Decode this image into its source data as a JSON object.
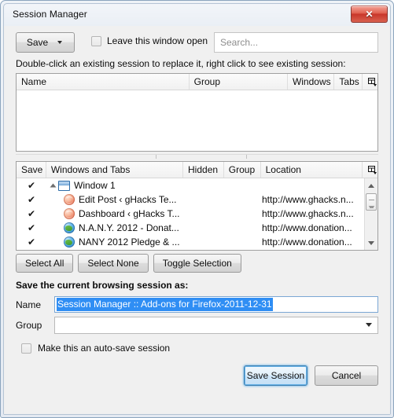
{
  "window": {
    "title": "Session Manager",
    "close_label": "✕"
  },
  "toolbar": {
    "save_label": "Save",
    "save_dropdown_icon": "chevron-down-icon",
    "leave_open_label": "Leave this window open",
    "leave_open_checked": false,
    "search_placeholder": "Search...",
    "search_value": ""
  },
  "hint": {
    "text": "Double-click an existing session to replace it, right click to see existing session:"
  },
  "sessions_table": {
    "columns": [
      {
        "label": "Name"
      },
      {
        "label": "Group"
      },
      {
        "label": "Windows"
      },
      {
        "label": "Tabs"
      }
    ],
    "column_picker_icon": "column-picker-icon",
    "rows": []
  },
  "tabs_table": {
    "columns": [
      {
        "label": "Save"
      },
      {
        "label": "Windows and Tabs"
      },
      {
        "label": "Hidden"
      },
      {
        "label": "Group"
      },
      {
        "label": "Location"
      }
    ],
    "column_picker_icon": "column-picker-icon",
    "rows": [
      {
        "save_check": "✔",
        "icon": "window-icon",
        "title": "Window 1",
        "hidden": "",
        "group": "",
        "location": "",
        "is_window": true,
        "expanded": true
      },
      {
        "save_check": "✔",
        "icon": "wordpress-favicon",
        "title": "Edit Post ‹ gHacks Te...",
        "hidden": "",
        "group": "",
        "location": "http://www.ghacks.n...",
        "is_window": false,
        "expanded": false
      },
      {
        "save_check": "✔",
        "icon": "wordpress-favicon",
        "title": "Dashboard ‹ gHacks T...",
        "hidden": "",
        "group": "",
        "location": "http://www.ghacks.n...",
        "is_window": false,
        "expanded": false
      },
      {
        "save_check": "✔",
        "icon": "globe-favicon",
        "title": "N.A.N.Y. 2012 - Donat...",
        "hidden": "",
        "group": "",
        "location": "http://www.donation...",
        "is_window": false,
        "expanded": false
      },
      {
        "save_check": "✔",
        "icon": "globe-favicon",
        "title": "NANY 2012 Pledge & ...",
        "hidden": "",
        "group": "",
        "location": "http://www.donation...",
        "is_window": false,
        "expanded": false
      }
    ]
  },
  "selection_buttons": {
    "select_all": "Select All",
    "select_none": "Select None",
    "toggle_selection": "Toggle Selection"
  },
  "save_as": {
    "heading": "Save the current browsing session as:",
    "name_label": "Name",
    "name_value": "Session Manager :: Add-ons for Firefox-2011-12-31",
    "name_selected": true,
    "group_label": "Group",
    "group_value": "",
    "group_arrow_icon": "chevron-down-icon"
  },
  "autosave": {
    "label": "Make this an auto-save session",
    "checked": false
  },
  "dialog_buttons": {
    "save_session": "Save Session",
    "cancel": "Cancel"
  },
  "colors": {
    "selection_blue": "#2f8ef4",
    "focus_ring_blue": "#68b3e8",
    "close_red": "#c8362a",
    "dialog_background": "#f0f0f0"
  }
}
